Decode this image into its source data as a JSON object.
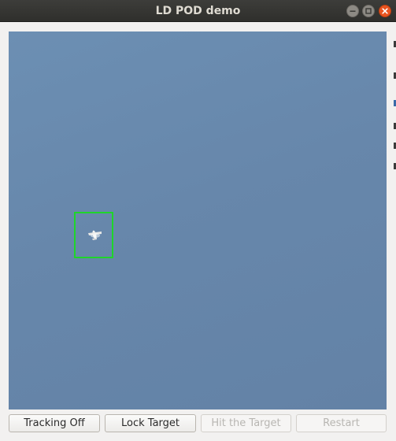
{
  "window": {
    "title": "LD POD demo"
  },
  "controls": {
    "buttons": [
      {
        "label": "Tracking Off",
        "enabled": true
      },
      {
        "label": "Lock Target",
        "enabled": true
      },
      {
        "label": "Hit the Target",
        "enabled": false
      },
      {
        "label": "Restart",
        "enabled": false
      }
    ]
  },
  "video": {
    "tracking_box_color": "#1fd52a",
    "sky_color": "#6787ab"
  },
  "colors": {
    "close_button": "#e95420",
    "titlebar": "#2f2f2c"
  }
}
